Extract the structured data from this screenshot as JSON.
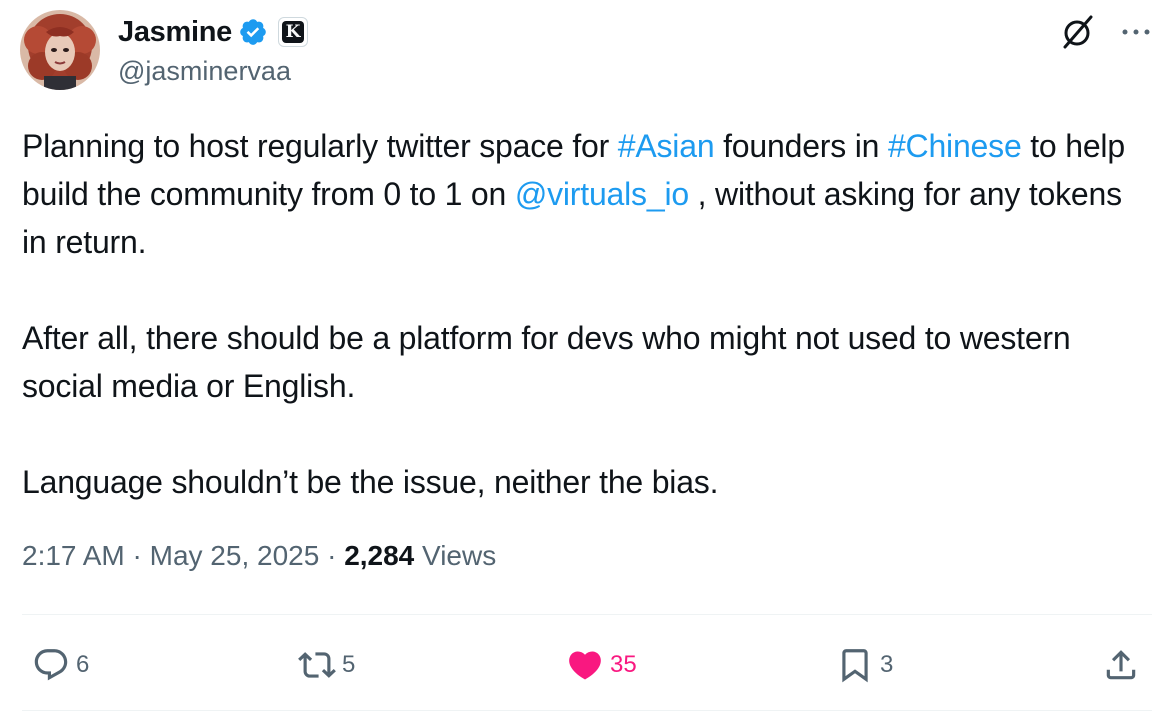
{
  "author": {
    "display_name": "Jasmine",
    "handle": "@jasminervaa",
    "affiliate_badge_letter": "K",
    "verified_color": "#1d9bf0",
    "avatar": "avatar-portrait"
  },
  "tweet": {
    "paragraph1": {
      "t1": "Planning to host regularly twitter space for ",
      "tag1": "#Asian",
      "t2": " founders in ",
      "tag2": "#Chinese",
      "t3": " to help build the community from 0 to 1 on ",
      "mention": "@virtuals_io",
      "t4": " , without asking for any tokens in return."
    },
    "paragraph2": "After all, there should be a platform for devs who might not used to western social media or English.",
    "paragraph3": "Language shouldn’t be the issue, neither the bias."
  },
  "meta": {
    "time": "2:17 AM",
    "sep1": " · ",
    "date": "May 25, 2025",
    "sep2": " · ",
    "views_count": "2,284",
    "views_label": " Views"
  },
  "actions": {
    "reply_count": "6",
    "retweet_count": "5",
    "like_count": "35",
    "bookmark_count": "3"
  },
  "colors": {
    "link": "#1d9bf0",
    "secondary_text": "#536471",
    "like_active": "#f91880",
    "divider": "#eff3f4"
  },
  "icons": {
    "top_right": [
      "grok-icon",
      "more-icon"
    ],
    "actions": [
      "reply-icon",
      "retweet-icon",
      "like-icon",
      "bookmark-icon",
      "share-icon"
    ]
  }
}
